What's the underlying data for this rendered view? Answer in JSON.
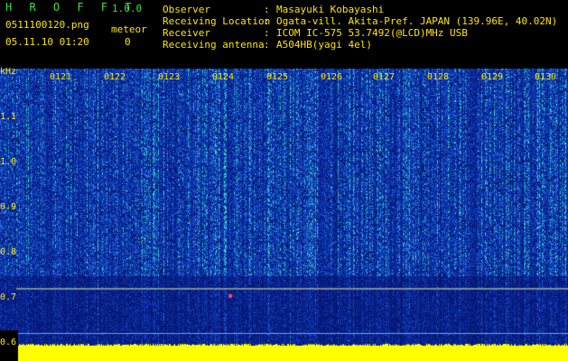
{
  "header": {
    "app_title": "H R O F F T",
    "version": "1.0.0",
    "filename": "0511100120.png",
    "datetime": "05.11.10 01:20",
    "meteor_label": "meteor",
    "meteor_count": "0"
  },
  "info": [
    {
      "label": "Observer",
      "value": "Masayuki Kobayashi"
    },
    {
      "label": "Receiving Location",
      "value": "Ogata-vill. Akita-Pref. JAPAN (139.96E, 40.02N)"
    },
    {
      "label": "Receiver",
      "value": "ICOM IC-575 53.7492(@LCD)MHz USB"
    },
    {
      "label": "Receiving antenna",
      "value": "A504HB(yagi 4el)"
    }
  ],
  "chart_data": {
    "type": "heatmap",
    "ylabel": "kHz",
    "y_ticks": [
      "1.1",
      "1.0",
      "0.9",
      "0.8",
      "0.7",
      "0.6"
    ],
    "x_ticks": [
      "0121",
      "0122",
      "0123",
      "0124",
      "0125",
      "0126",
      "0127",
      "0128",
      "0129",
      "0130"
    ],
    "colors": {
      "background": "#0a1a7a",
      "noise": "#1e4fd0",
      "line": "#ff5050",
      "signal": "#ffff00"
    }
  }
}
